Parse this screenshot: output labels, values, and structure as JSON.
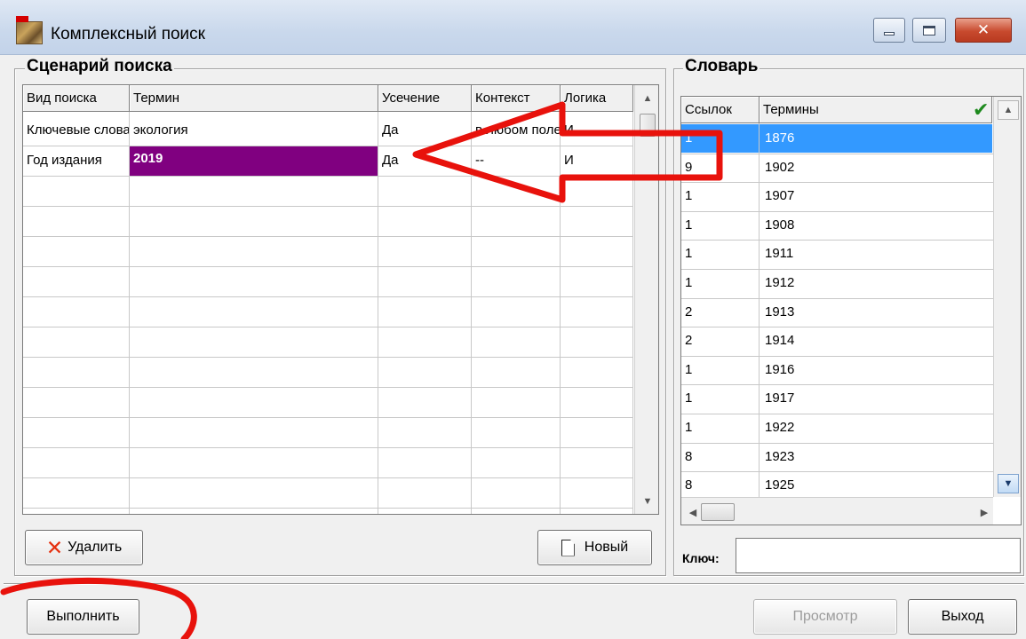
{
  "window": {
    "title": "Комплексный поиск"
  },
  "scenario": {
    "group_title": "Сценарий поиска",
    "columns": [
      "Вид поиска",
      "Термин",
      "Усечение",
      "Контекст",
      "Логика"
    ],
    "rows": [
      [
        "Ключевые слова",
        "экология",
        "Да",
        "в любом поле",
        "И"
      ],
      [
        "Год издания",
        "2019",
        "Да",
        "--",
        "И"
      ]
    ],
    "delete_label": "Удалить",
    "new_label": "Новый"
  },
  "dictionary": {
    "group_title": "Словарь",
    "columns": [
      "Ссылок",
      "Термины"
    ],
    "rows": [
      [
        "1",
        "1876"
      ],
      [
        "9",
        "1902"
      ],
      [
        "1",
        "1907"
      ],
      [
        "1",
        "1908"
      ],
      [
        "1",
        "1911"
      ],
      [
        "1",
        "1912"
      ],
      [
        "2",
        "1913"
      ],
      [
        "2",
        "1914"
      ],
      [
        "1",
        "1916"
      ],
      [
        "1",
        "1917"
      ],
      [
        "1",
        "1922"
      ],
      [
        "8",
        "1923"
      ],
      [
        "8",
        "1925"
      ]
    ],
    "key_label": "Ключ:",
    "key_value": ""
  },
  "footer": {
    "execute_label": "Выполнить",
    "view_label": "Просмотр",
    "exit_label": "Выход"
  },
  "colors": {
    "selected_cell": "#800080",
    "dictionary_selection": "#3399ff",
    "annotation": "#e8120c"
  }
}
